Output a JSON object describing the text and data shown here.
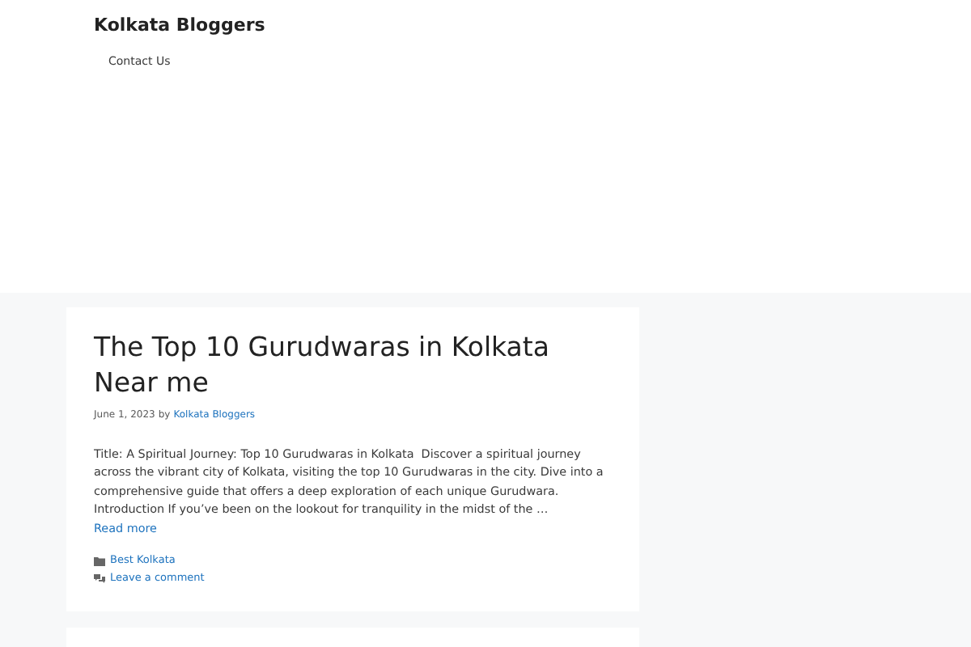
{
  "site": {
    "title": "Kolkata Bloggers",
    "menu": [
      "Contact Us"
    ]
  },
  "posts": [
    {
      "title": "The Top 10 Gurudwaras in Kolkata Near me",
      "date": "June 1, 2023",
      "by": "by",
      "author": "Kolkata Bloggers",
      "excerpt": "Title: A Spiritual Journey: Top 10 Gurudwaras in Kolkata  Discover a spiritual journey across the vibrant city of Kolkata, visiting the top 10 Gurudwaras in the city. Dive into a comprehensive guide that offers a deep exploration of each unique Gurudwara. Introduction If you’ve been on the lookout for tranquility in the midst of the …",
      "read_more": "Read more",
      "category": "Best Kolkata",
      "comments": "Leave a comment"
    }
  ]
}
